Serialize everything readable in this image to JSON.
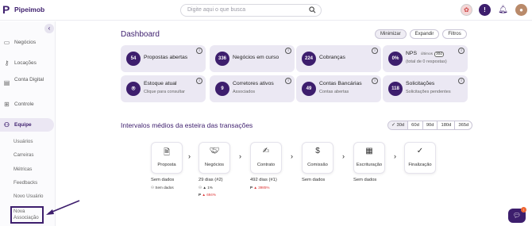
{
  "app": {
    "name": "Pipeimob"
  },
  "search": {
    "placeholder": "Digite aqui o que busca"
  },
  "sidebar": {
    "items": [
      {
        "label": "Negócios",
        "icon": "briefcase-icon"
      },
      {
        "label": "Locações",
        "icon": "key-icon"
      },
      {
        "label": "Conta Digital",
        "icon": "card-icon"
      },
      {
        "label": "Controle",
        "icon": "grid-icon"
      },
      {
        "label": "Equipe",
        "icon": "team-icon"
      }
    ],
    "sub_items": [
      "Usuários",
      "Carreiras",
      "Métricas",
      "Feedbacks",
      "Novo Usuário",
      "Nova Associação"
    ]
  },
  "dashboard": {
    "title": "Dashboard",
    "buttons": [
      "Minimizar",
      "Expandir",
      "Filtros"
    ],
    "cards": [
      {
        "value": "54",
        "title": "Propostas abertas",
        "sub": ""
      },
      {
        "value": "336",
        "title": "Negócios em curso",
        "sub": ""
      },
      {
        "value": "224",
        "title": "Cobranças",
        "sub": ""
      },
      {
        "value": "0%",
        "title": "NPS",
        "badge_prefix": "últimos",
        "badge": "30d",
        "sub": "(total de 0 respostas)"
      },
      {
        "value": "",
        "title": "Estoque atual",
        "sub": "Clique para consultar"
      },
      {
        "value": "9",
        "title": "Corretores ativos",
        "sub": "Associados"
      },
      {
        "value": "49",
        "title": "Contas Bancárias",
        "sub": "Contas abertas"
      },
      {
        "value": "118",
        "title": "Solicitações",
        "sub": "Solicitações pendentes"
      }
    ]
  },
  "pipeline": {
    "title": "Intervalos médios da esteira das transações",
    "periods": [
      "30d",
      "60d",
      "90d",
      "180d",
      "365d"
    ],
    "steps": [
      {
        "label": "Proposta",
        "icon": "document-icon"
      },
      {
        "label": "Negócios",
        "icon": "handshake-icon"
      },
      {
        "label": "Contrato",
        "icon": "signature-icon"
      },
      {
        "label": "Comissão",
        "icon": "dollar-icon"
      },
      {
        "label": "Escrituração",
        "icon": "calendar-icon"
      },
      {
        "label": "Finalização",
        "icon": "check-icon"
      }
    ],
    "stats": {
      "proposta": {
        "main": "Sem dados",
        "sub": "Sem dados"
      },
      "negocios": {
        "main": "29 dias (#2)",
        "sub1": "1%",
        "sub2": "694%"
      },
      "contrato": {
        "main": "492 dias (#1)",
        "sub2": "3985%"
      },
      "comissao": {
        "main": "Sem dados"
      },
      "escrituracao": {
        "main": "Sem dados"
      }
    }
  },
  "colors": {
    "brand": "#3d1e6d",
    "card_bg": "#ebe8f3",
    "negative": "#dd3333"
  }
}
